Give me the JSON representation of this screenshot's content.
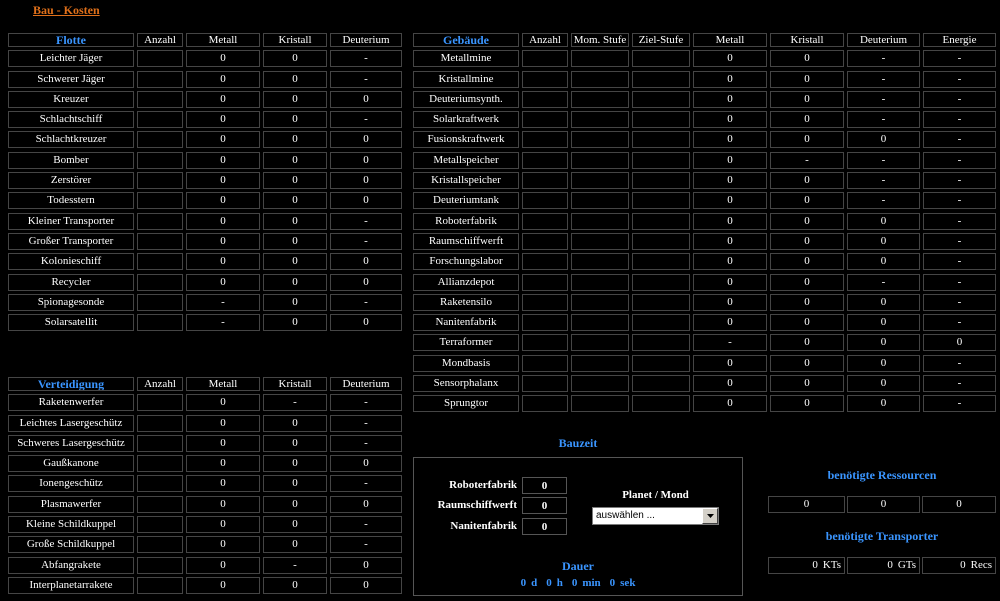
{
  "page": {
    "title": "Bau - Kosten"
  },
  "colors": {
    "accent": "#3a95ff",
    "title": "#e0701a",
    "background": "#000000",
    "text": "#ffffff",
    "border": "#454545"
  },
  "fleet": {
    "heading": "Flotte",
    "columns": [
      "Anzahl",
      "Metall",
      "Kristall",
      "Deuterium"
    ],
    "rows": [
      {
        "name": "Leichter Jäger",
        "metal": "0",
        "crystal": "0",
        "deuterium": "-"
      },
      {
        "name": "Schwerer Jäger",
        "metal": "0",
        "crystal": "0",
        "deuterium": "-"
      },
      {
        "name": "Kreuzer",
        "metal": "0",
        "crystal": "0",
        "deuterium": "0"
      },
      {
        "name": "Schlachtschiff",
        "metal": "0",
        "crystal": "0",
        "deuterium": "-"
      },
      {
        "name": "Schlachtkreuzer",
        "metal": "0",
        "crystal": "0",
        "deuterium": "0"
      },
      {
        "name": "Bomber",
        "metal": "0",
        "crystal": "0",
        "deuterium": "0"
      },
      {
        "name": "Zerstörer",
        "metal": "0",
        "crystal": "0",
        "deuterium": "0"
      },
      {
        "name": "Todesstern",
        "metal": "0",
        "crystal": "0",
        "deuterium": "0"
      },
      {
        "name": "Kleiner Transporter",
        "metal": "0",
        "crystal": "0",
        "deuterium": "-"
      },
      {
        "name": "Großer Transporter",
        "metal": "0",
        "crystal": "0",
        "deuterium": "-"
      },
      {
        "name": "Kolonieschiff",
        "metal": "0",
        "crystal": "0",
        "deuterium": "0"
      },
      {
        "name": "Recycler",
        "metal": "0",
        "crystal": "0",
        "deuterium": "0"
      },
      {
        "name": "Spionagesonde",
        "metal": "-",
        "crystal": "0",
        "deuterium": "-"
      },
      {
        "name": "Solarsatellit",
        "metal": "-",
        "crystal": "0",
        "deuterium": "0"
      }
    ]
  },
  "defense": {
    "heading": "Verteidigung",
    "columns": [
      "Anzahl",
      "Metall",
      "Kristall",
      "Deuterium"
    ],
    "rows": [
      {
        "name": "Raketenwerfer",
        "metal": "0",
        "crystal": "-",
        "deuterium": "-"
      },
      {
        "name": "Leichtes Lasergeschütz",
        "metal": "0",
        "crystal": "0",
        "deuterium": "-"
      },
      {
        "name": "Schweres Lasergeschütz",
        "metal": "0",
        "crystal": "0",
        "deuterium": "-"
      },
      {
        "name": "Gaußkanone",
        "metal": "0",
        "crystal": "0",
        "deuterium": "0"
      },
      {
        "name": "Ionengeschütz",
        "metal": "0",
        "crystal": "0",
        "deuterium": "-"
      },
      {
        "name": "Plasmawerfer",
        "metal": "0",
        "crystal": "0",
        "deuterium": "0"
      },
      {
        "name": "Kleine Schildkuppel",
        "metal": "0",
        "crystal": "0",
        "deuterium": "-"
      },
      {
        "name": "Große Schildkuppel",
        "metal": "0",
        "crystal": "0",
        "deuterium": "-"
      },
      {
        "name": "Abfangrakete",
        "metal": "0",
        "crystal": "-",
        "deuterium": "0"
      },
      {
        "name": "Interplanetarrakete",
        "metal": "0",
        "crystal": "0",
        "deuterium": "0"
      }
    ]
  },
  "buildings": {
    "heading": "Gebäude",
    "columns": [
      "Anzahl",
      "Mom. Stufe",
      "Ziel-Stufe",
      "Metall",
      "Kristall",
      "Deuterium",
      "Energie"
    ],
    "rows": [
      {
        "name": "Metallmine",
        "metal": "0",
        "crystal": "0",
        "deuterium": "-",
        "energy": "-"
      },
      {
        "name": "Kristallmine",
        "metal": "0",
        "crystal": "0",
        "deuterium": "-",
        "energy": "-"
      },
      {
        "name": "Deuteriumsynth.",
        "metal": "0",
        "crystal": "0",
        "deuterium": "-",
        "energy": "-"
      },
      {
        "name": "Solarkraftwerk",
        "metal": "0",
        "crystal": "0",
        "deuterium": "-",
        "energy": "-"
      },
      {
        "name": "Fusionskraftwerk",
        "metal": "0",
        "crystal": "0",
        "deuterium": "0",
        "energy": "-"
      },
      {
        "name": "Metallspeicher",
        "metal": "0",
        "crystal": "-",
        "deuterium": "-",
        "energy": "-"
      },
      {
        "name": "Kristallspeicher",
        "metal": "0",
        "crystal": "0",
        "deuterium": "-",
        "energy": "-"
      },
      {
        "name": "Deuteriumtank",
        "metal": "0",
        "crystal": "0",
        "deuterium": "-",
        "energy": "-"
      },
      {
        "name": "Roboterfabrik",
        "metal": "0",
        "crystal": "0",
        "deuterium": "0",
        "energy": "-"
      },
      {
        "name": "Raumschiffwerft",
        "metal": "0",
        "crystal": "0",
        "deuterium": "0",
        "energy": "-"
      },
      {
        "name": "Forschungslabor",
        "metal": "0",
        "crystal": "0",
        "deuterium": "0",
        "energy": "-"
      },
      {
        "name": "Allianzdepot",
        "metal": "0",
        "crystal": "0",
        "deuterium": "-",
        "energy": "-"
      },
      {
        "name": "Raketensilo",
        "metal": "0",
        "crystal": "0",
        "deuterium": "0",
        "energy": "-"
      },
      {
        "name": "Nanitenfabrik",
        "metal": "0",
        "crystal": "0",
        "deuterium": "0",
        "energy": "-"
      },
      {
        "name": "Terraformer",
        "metal": "-",
        "crystal": "0",
        "deuterium": "0",
        "energy": "0"
      },
      {
        "name": "Mondbasis",
        "metal": "0",
        "crystal": "0",
        "deuterium": "0",
        "energy": "-"
      },
      {
        "name": "Sensorphalanx",
        "metal": "0",
        "crystal": "0",
        "deuterium": "0",
        "energy": "-"
      },
      {
        "name": "Sprungtor",
        "metal": "0",
        "crystal": "0",
        "deuterium": "0",
        "energy": "-"
      }
    ]
  },
  "build_time": {
    "heading": "Bauzeit",
    "factories": [
      {
        "label": "Roboterfabrik",
        "value": "0"
      },
      {
        "label": "Raumschiffwerft",
        "value": "0"
      },
      {
        "label": "Nanitenfabrik",
        "value": "0"
      }
    ],
    "planet_label": "Planet / Mond",
    "planet_select": "auswählen ...",
    "duration_label": "Dauer",
    "duration": [
      {
        "value": "0",
        "unit": "d"
      },
      {
        "value": "0",
        "unit": "h"
      },
      {
        "value": "0",
        "unit": "min"
      },
      {
        "value": "0",
        "unit": "sek"
      }
    ]
  },
  "required_resources": {
    "heading": "benötigte Ressourcen",
    "values": [
      "0",
      "0",
      "0"
    ]
  },
  "required_transporters": {
    "heading": "benötigte Transporter",
    "items": [
      {
        "value": "0",
        "unit": "KTs"
      },
      {
        "value": "0",
        "unit": "GTs"
      },
      {
        "value": "0",
        "unit": "Recs"
      }
    ]
  },
  "icons": {
    "select_toggle": "chevron-down-icon"
  }
}
